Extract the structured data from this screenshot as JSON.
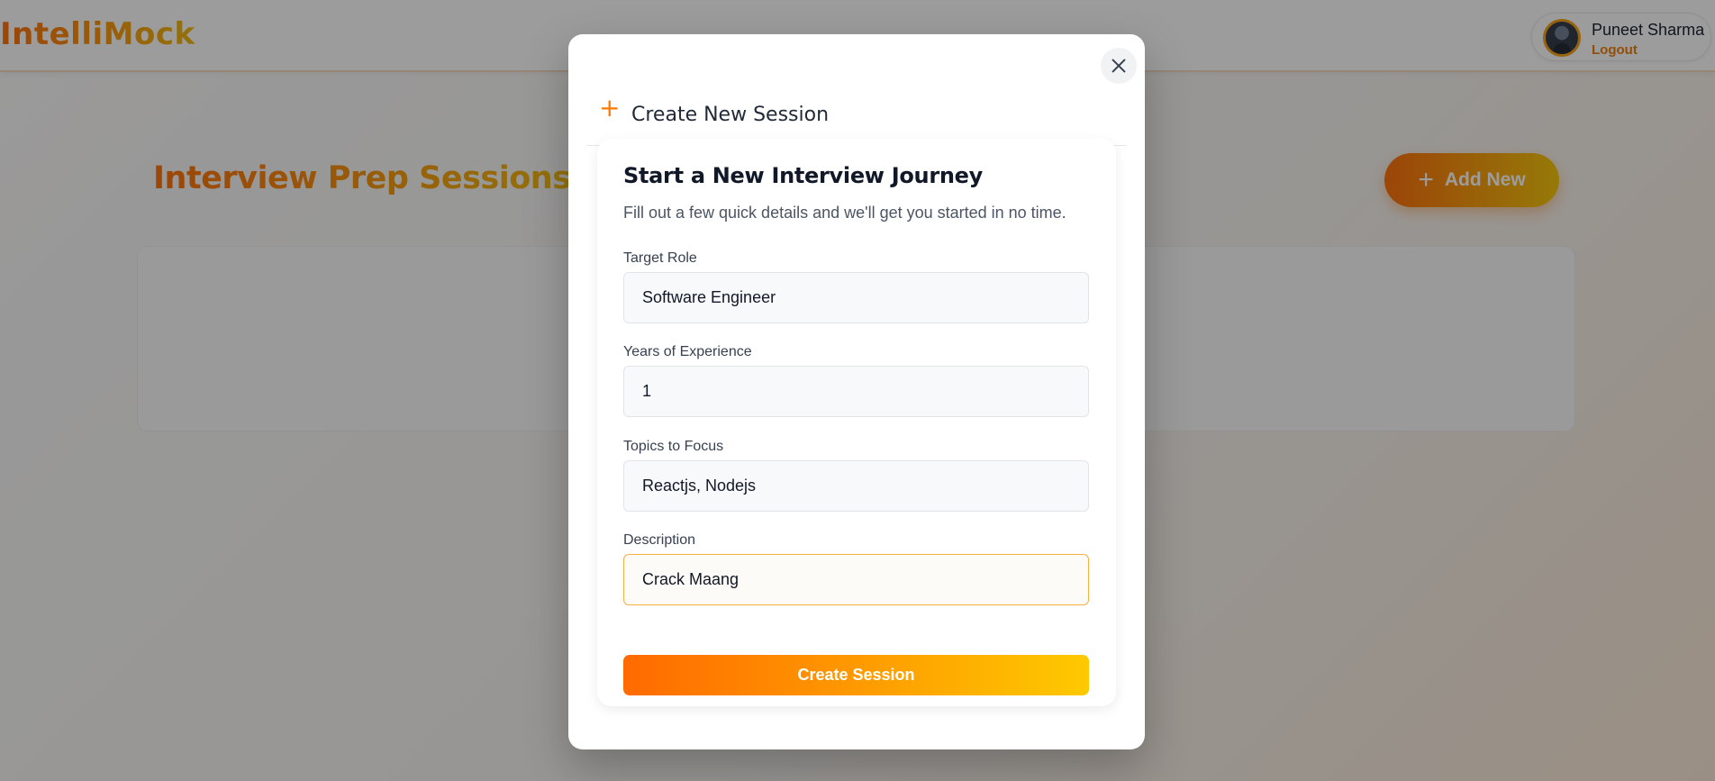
{
  "app": {
    "logo": "IntelliMock"
  },
  "user": {
    "name": "Puneet Sharma",
    "logout_label": "Logout"
  },
  "page": {
    "title": "Interview Prep Sessions",
    "add_new_label": "Add New"
  },
  "modal": {
    "title": "Create New Session",
    "form": {
      "heading": "Start a New Interview Journey",
      "subtitle": "Fill out a few quick details and we'll get you started in no time.",
      "fields": [
        {
          "label": "Target Role",
          "value": "Software Engineer"
        },
        {
          "label": "Years of Experience",
          "value": "1"
        },
        {
          "label": "Topics to Focus",
          "value": "Reactjs, Nodejs"
        },
        {
          "label": "Description",
          "value": "Crack Maang"
        }
      ],
      "submit_label": "Create Session"
    }
  },
  "colors": {
    "accent_start": "#ff6a00",
    "accent_end": "#f5c400",
    "focus_border": "#f5b042"
  },
  "icons": {
    "modal_add": "plus-icon",
    "close": "close-icon",
    "add_new": "plus-icon"
  }
}
